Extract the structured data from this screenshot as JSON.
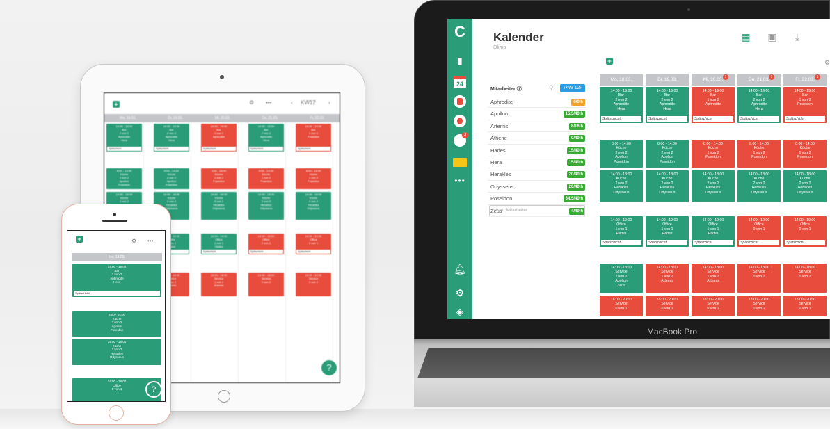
{
  "laptop": {
    "brand": "MacBook Pro",
    "app": {
      "title": "Kalender",
      "subtitle": "Olimp",
      "sidebar": {
        "calendar_day": "24",
        "clock_badge": "3"
      },
      "employees": {
        "header": "Mitarbeiter",
        "week_button": "‹KW 12›",
        "new_placeholder": "Neuer Mitarbeiter",
        "rows": [
          {
            "name": "Aphrodite",
            "hours": "0/0 h",
            "color": "#f0a22a"
          },
          {
            "name": "Apollon",
            "hours": "15.5/40 h",
            "color": "#3aa935"
          },
          {
            "name": "Artemis",
            "hours": "8/16 h",
            "color": "#3aa935"
          },
          {
            "name": "Athene",
            "hours": "0/40 h",
            "color": "#3aa935"
          },
          {
            "name": "Hades",
            "hours": "15/40 h",
            "color": "#3aa935"
          },
          {
            "name": "Hera",
            "hours": "15/40 h",
            "color": "#3aa935"
          },
          {
            "name": "Herakles",
            "hours": "20/40 h",
            "color": "#3aa935"
          },
          {
            "name": "Odysseus",
            "hours": "20/40 h",
            "color": "#3aa935"
          },
          {
            "name": "Poseidon",
            "hours": "34.5/40 h",
            "color": "#3aa935"
          },
          {
            "name": "Zeus",
            "hours": "4/40 h",
            "color": "#3aa935"
          }
        ]
      },
      "days": [
        {
          "label": "Mo, 18.03.",
          "badge": ""
        },
        {
          "label": "Di, 19.03.",
          "badge": ""
        },
        {
          "label": "Mi, 20.03.",
          "badge": "1"
        },
        {
          "label": "Do, 21.03.",
          "badge": "1"
        },
        {
          "label": "Fr, 22.03.",
          "badge": "1"
        }
      ],
      "shift_tag": "Spätschicht",
      "shifts": [
        {
          "day": 0,
          "row": 0,
          "color": "green",
          "lines": [
            "14:00 - 19:00",
            "Bar",
            "2 von 2",
            "Aphrodite",
            "Hera"
          ],
          "tag": true
        },
        {
          "day": 1,
          "row": 0,
          "color": "green",
          "lines": [
            "14:00 - 19:00",
            "Bar",
            "2 von 2",
            "Aphrodite",
            "Hera"
          ],
          "tag": true
        },
        {
          "day": 2,
          "row": 0,
          "color": "red",
          "lines": [
            "14:00 - 19:00",
            "Bar",
            "1 von 2",
            "Aphrodite"
          ],
          "tag": true
        },
        {
          "day": 3,
          "row": 0,
          "color": "green",
          "lines": [
            "14:00 - 19:00",
            "Bar",
            "2 von 2",
            "Aphrodite",
            "Hera"
          ],
          "tag": true
        },
        {
          "day": 4,
          "row": 0,
          "color": "red",
          "lines": [
            "14:00 - 19:00",
            "Bar",
            "1 von 2",
            "Poseidon"
          ],
          "tag": true
        },
        {
          "day": 0,
          "row": 1,
          "color": "green",
          "lines": [
            "8:00 - 14:00",
            "Küche",
            "2 von 2",
            "Apollon",
            "Poseidon"
          ],
          "tag": false
        },
        {
          "day": 1,
          "row": 1,
          "color": "green",
          "lines": [
            "8:00 - 14:00",
            "Küche",
            "2 von 2",
            "Apollon",
            "Poseidon"
          ],
          "tag": false
        },
        {
          "day": 2,
          "row": 1,
          "color": "red",
          "lines": [
            "8:00 - 14:00",
            "Küche",
            "1 von 2",
            "Poseidon"
          ],
          "tag": false
        },
        {
          "day": 3,
          "row": 1,
          "color": "red",
          "lines": [
            "8:00 - 14:00",
            "Küche",
            "1 von 2",
            "Poseidon"
          ],
          "tag": false
        },
        {
          "day": 4,
          "row": 1,
          "color": "red",
          "lines": [
            "8:00 - 14:00",
            "Küche",
            "1 von 2",
            "Poseidon"
          ],
          "tag": false
        },
        {
          "day": 0,
          "row": 2,
          "color": "green",
          "lines": [
            "14:00 - 18:00",
            "Küche",
            "2 von 2",
            "Herakles",
            "Odysseus"
          ],
          "tag": false
        },
        {
          "day": 1,
          "row": 2,
          "color": "green",
          "lines": [
            "14:00 - 18:00",
            "Küche",
            "2 von 2",
            "Herakles",
            "Odysseus"
          ],
          "tag": false
        },
        {
          "day": 2,
          "row": 2,
          "color": "green",
          "lines": [
            "14:00 - 18:00",
            "Küche",
            "2 von 2",
            "Herakles",
            "Odysseus"
          ],
          "tag": false
        },
        {
          "day": 3,
          "row": 2,
          "color": "green",
          "lines": [
            "14:00 - 18:00",
            "Küche",
            "2 von 2",
            "Herakles",
            "Odysseus"
          ],
          "tag": false
        },
        {
          "day": 4,
          "row": 2,
          "color": "green",
          "lines": [
            "14:00 - 18:00",
            "Küche",
            "2 von 2",
            "Herakles",
            "Odysseus"
          ],
          "tag": false
        },
        {
          "day": 0,
          "row": 3,
          "color": "green",
          "lines": [
            "14:00 - 19:00",
            "Office",
            "1 von 1",
            "Hades"
          ],
          "tag": true
        },
        {
          "day": 1,
          "row": 3,
          "color": "green",
          "lines": [
            "14:00 - 19:00",
            "Office",
            "1 von 1",
            "Hades"
          ],
          "tag": true
        },
        {
          "day": 2,
          "row": 3,
          "color": "green",
          "lines": [
            "14:00 - 19:00",
            "Office",
            "1 von 1",
            "Hades"
          ],
          "tag": true
        },
        {
          "day": 3,
          "row": 3,
          "color": "red",
          "lines": [
            "14:00 - 19:00",
            "Office",
            "0 von 1"
          ],
          "tag": true
        },
        {
          "day": 4,
          "row": 3,
          "color": "red",
          "lines": [
            "14:00 - 19:00",
            "Office",
            "0 von 1"
          ],
          "tag": true
        },
        {
          "day": 0,
          "row": 4,
          "color": "green",
          "lines": [
            "14:00 - 18:00",
            "Service",
            "2 von 2",
            "Apollon",
            "Zeus"
          ],
          "tag": false
        },
        {
          "day": 1,
          "row": 4,
          "color": "red",
          "lines": [
            "14:00 - 18:00",
            "Service",
            "1 von 2",
            "Artemis"
          ],
          "tag": false
        },
        {
          "day": 2,
          "row": 4,
          "color": "red",
          "lines": [
            "14:00 - 18:00",
            "Service",
            "1 von 2",
            "Artemis"
          ],
          "tag": false
        },
        {
          "day": 3,
          "row": 4,
          "color": "red",
          "lines": [
            "14:00 - 18:00",
            "Service",
            "0 von 2"
          ],
          "tag": false
        },
        {
          "day": 4,
          "row": 4,
          "color": "red",
          "lines": [
            "14:00 - 18:00",
            "Service",
            "0 von 2"
          ],
          "tag": false
        },
        {
          "day": 0,
          "row": 5,
          "color": "red",
          "lines": [
            "18:00 - 20:00",
            "Service",
            "0 von 1"
          ],
          "tag": false
        },
        {
          "day": 1,
          "row": 5,
          "color": "red",
          "lines": [
            "18:00 - 20:00",
            "Service",
            "0 von 1"
          ],
          "tag": false
        },
        {
          "day": 2,
          "row": 5,
          "color": "red",
          "lines": [
            "18:00 - 20:00",
            "Service",
            "0 von 1"
          ],
          "tag": false
        },
        {
          "day": 3,
          "row": 5,
          "color": "red",
          "lines": [
            "18:00 - 20:00",
            "Service",
            "0 von 1"
          ],
          "tag": false
        },
        {
          "day": 4,
          "row": 5,
          "color": "red",
          "lines": [
            "18:00 - 20:00",
            "Service",
            "0 von 1"
          ],
          "tag": false
        }
      ]
    }
  },
  "tablet": {
    "week": "KW12",
    "more": "•••",
    "days": [
      "Mo, 18.03.",
      "Di, 19.03.",
      "Mi, 20.03.",
      "Do, 21.03.",
      "Fr, 22.03."
    ],
    "help": "?"
  },
  "phone": {
    "day": "Mo, 18.03.",
    "more": "•••",
    "help": "?",
    "shift_tag": "Spätschicht",
    "shifts": [
      {
        "lines": [
          "14:00 - 19:00",
          "Bar",
          "2 von 2",
          "Aphrodite",
          "Hera"
        ],
        "tag": true
      },
      {
        "lines": [
          "8:00 - 14:00",
          "Küche",
          "2 von 2",
          "Apollon",
          "Poseidon"
        ],
        "tag": false
      },
      {
        "lines": [
          "14:00 - 18:00",
          "Küche",
          "2 von 2",
          "Herakles",
          "Odysseus"
        ],
        "tag": false
      },
      {
        "lines": [
          "14:00 - 19:00",
          "Office",
          "1 von 1"
        ],
        "tag": false
      }
    ]
  },
  "colors": {
    "green": "#2a9d78",
    "red": "#e74c3c",
    "accent_blue": "#2c9ee0"
  }
}
